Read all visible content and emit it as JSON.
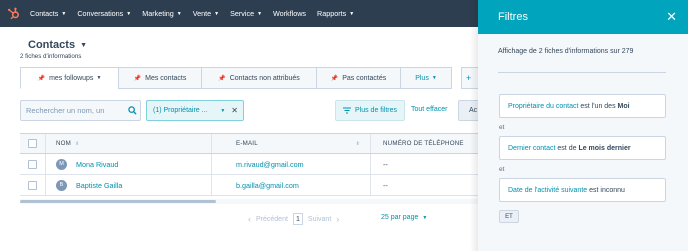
{
  "nav": {
    "items": [
      {
        "label": "Contacts",
        "dropdown": true
      },
      {
        "label": "Conversations",
        "dropdown": true
      },
      {
        "label": "Marketing",
        "dropdown": true
      },
      {
        "label": "Vente",
        "dropdown": true
      },
      {
        "label": "Service",
        "dropdown": true
      },
      {
        "label": "Workflows",
        "dropdown": false
      },
      {
        "label": "Rapports",
        "dropdown": true
      }
    ],
    "color": "#2d3e50",
    "logo_color": "#ff7a59"
  },
  "page": {
    "title": "Contacts",
    "record_count": "2 fiches d'informations"
  },
  "tabs": [
    {
      "label": "mes followups",
      "active": true,
      "dropdown": true
    },
    {
      "label": "Mes contacts",
      "active": false
    },
    {
      "label": "Contacts non attribués",
      "active": false
    },
    {
      "label": "Pas contactés",
      "active": false
    },
    {
      "label": "Plus",
      "dropdown": true
    }
  ],
  "toolbar": {
    "search_placeholder": "Rechercher un nom, un",
    "filter_chip": "(1) Propriétaire ...",
    "more_filters": "Plus de filtres",
    "clear_all": "Tout effacer",
    "action_partial": "Ac"
  },
  "table": {
    "headers": {
      "name": "NOM",
      "email": "E-MAIL",
      "phone": "NUMÉRO DE TÉLÉPHONE"
    },
    "rows": [
      {
        "initials": "M",
        "name": "Mona Rivaud",
        "email": "m.rivaud@gmail.com",
        "phone": "--"
      },
      {
        "initials": "B",
        "name": "Baptiste Gailla",
        "email": "b.gailla@gmail.com",
        "phone": "--"
      }
    ]
  },
  "pagination": {
    "prev": "Précédent",
    "current_page": "1",
    "next": "Suivant",
    "per_page": "25 par page"
  },
  "panel": {
    "title": "Filtres",
    "summary": "Affichage de 2 fiches d'informations sur 279",
    "and_label": "et",
    "rules": [
      {
        "property": "Propriétaire du contact",
        "operator": " est l'un des ",
        "value": "Moi"
      },
      {
        "property": "Dernier contact",
        "operator": " est de ",
        "value": "Le mois dernier"
      },
      {
        "property": "Date de l'activité suivante",
        "operator": " est inconnu",
        "value": ""
      }
    ],
    "and_button": "ET",
    "accent": "#00a4bd"
  },
  "colors": {
    "link": "#0091ae",
    "text": "#33475b",
    "border": "#cbd6e2"
  }
}
